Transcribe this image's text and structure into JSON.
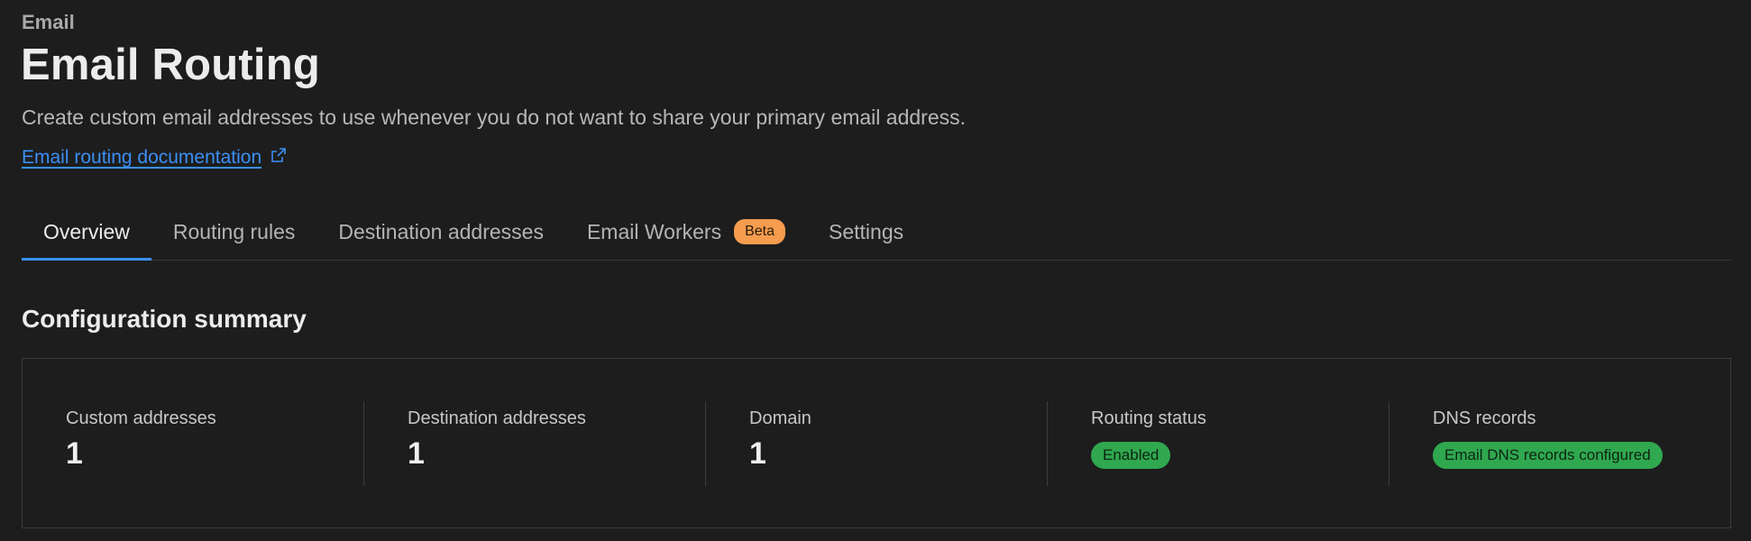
{
  "breadcrumb": "Email",
  "page_title": "Email Routing",
  "subtitle": "Create custom email addresses to use whenever you do not want to share your primary email address.",
  "doc_link": {
    "label": "Email routing documentation",
    "icon": "external-link-icon"
  },
  "tabs": [
    {
      "label": "Overview",
      "active": true
    },
    {
      "label": "Routing rules"
    },
    {
      "label": "Destination addresses"
    },
    {
      "label": "Email Workers",
      "badge": "Beta"
    },
    {
      "label": "Settings"
    }
  ],
  "section_title": "Configuration summary",
  "summary": {
    "custom_addresses": {
      "label": "Custom addresses",
      "value": "1"
    },
    "destination_addresses": {
      "label": "Destination addresses",
      "value": "1"
    },
    "domain": {
      "label": "Domain",
      "value": "1"
    },
    "routing_status": {
      "label": "Routing status",
      "badge": "Enabled"
    },
    "dns_records": {
      "label": "DNS records",
      "badge": "Email DNS records configured"
    }
  },
  "colors": {
    "background": "#1d1d1d",
    "accent": "#3b8ff5",
    "beta_badge": "#f59c4f",
    "success_badge": "#2fa84f"
  }
}
